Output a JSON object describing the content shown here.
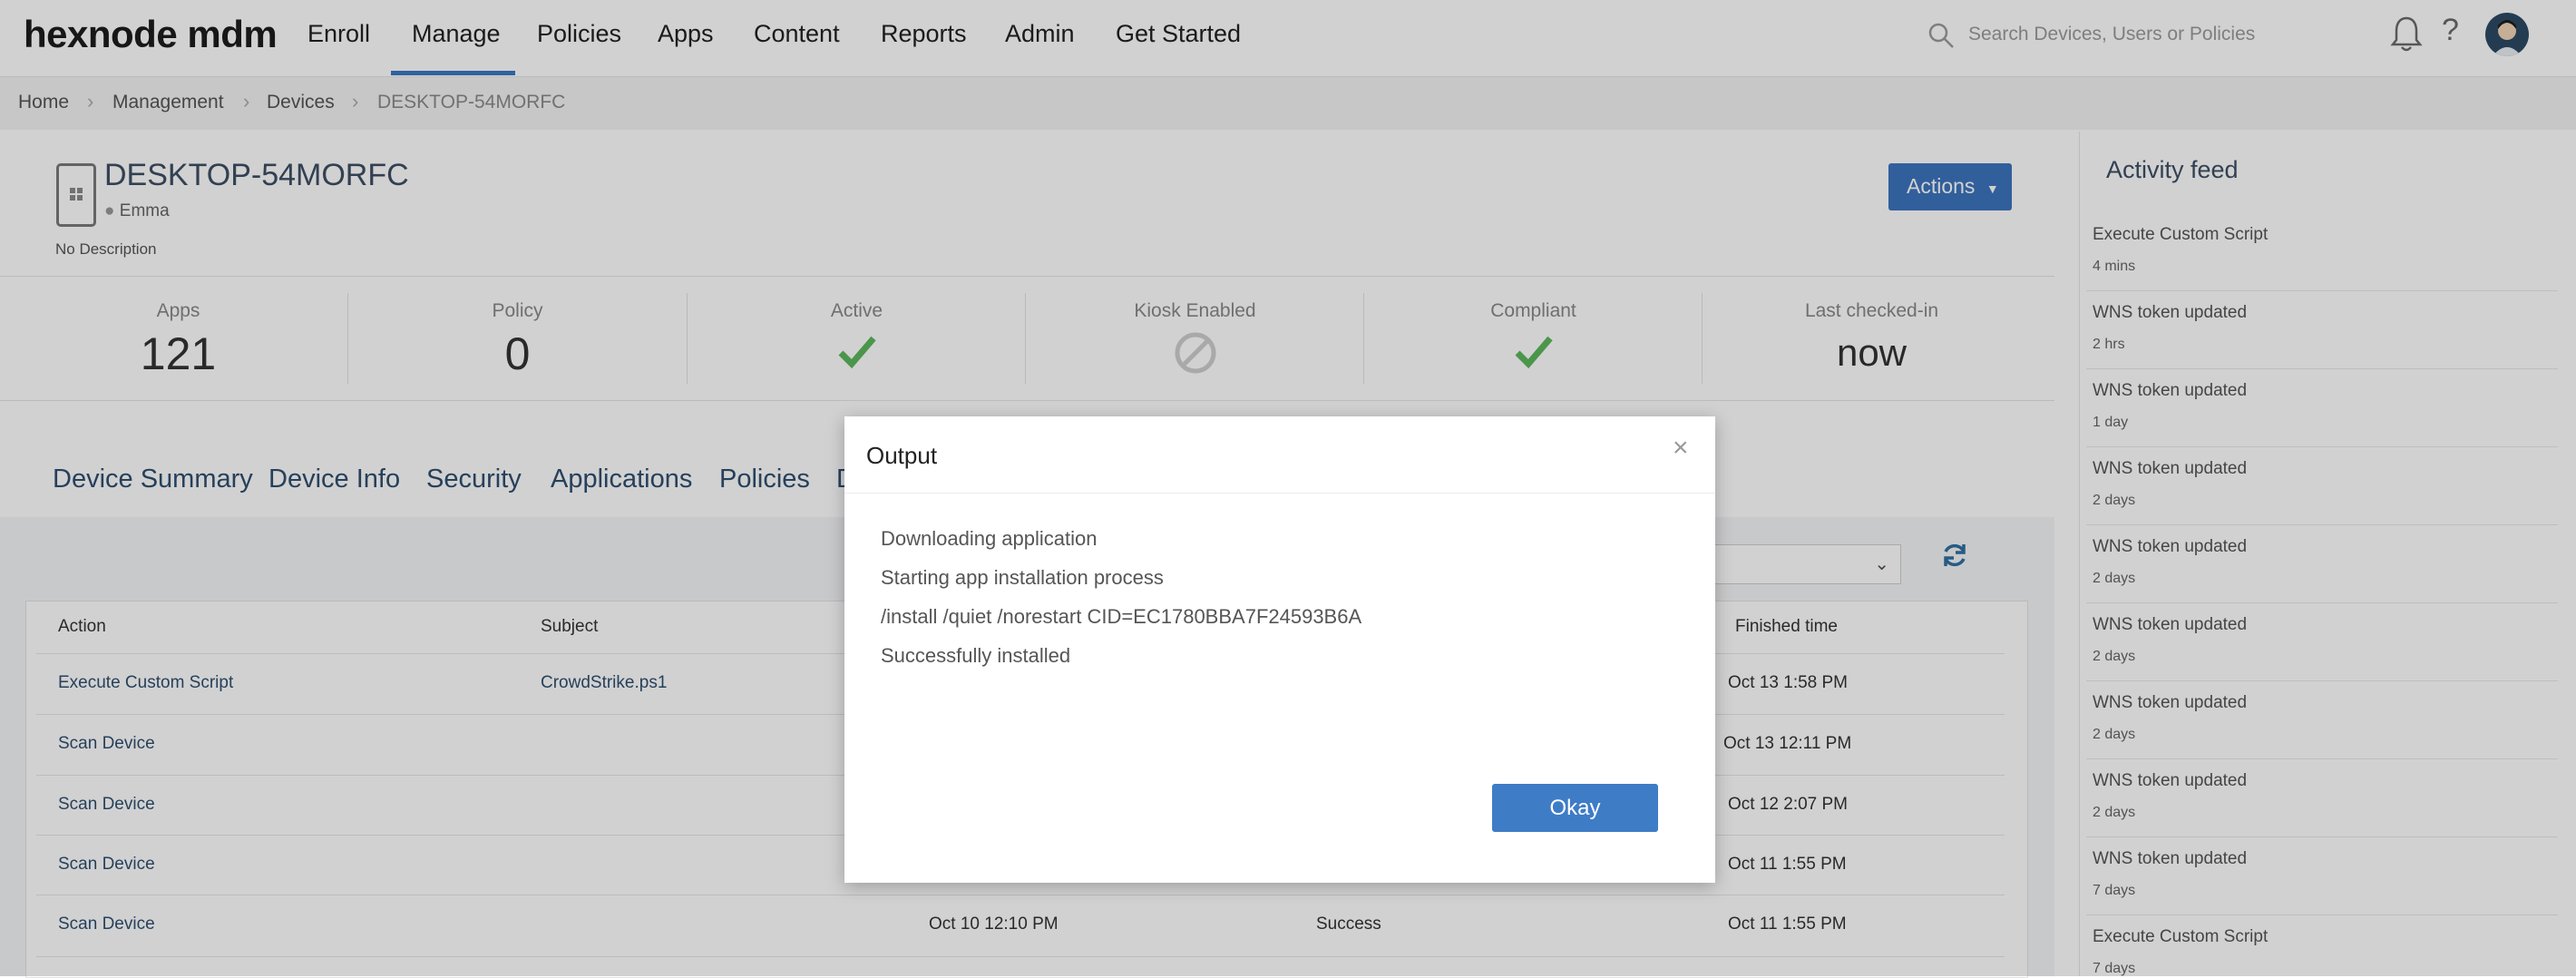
{
  "nav": {
    "logo": "hexnode mdm",
    "items": [
      "Enroll",
      "Manage",
      "Policies",
      "Apps",
      "Content",
      "Reports",
      "Admin",
      "Get Started"
    ],
    "active": "Manage",
    "search_placeholder": "Search Devices, Users or Policies"
  },
  "breadcrumb": [
    "Home",
    "Management",
    "Devices",
    "DESKTOP-54MORFC"
  ],
  "device": {
    "name": "DESKTOP-54MORFC",
    "user": "Emma",
    "description": "No Description",
    "actions_label": "Actions"
  },
  "stats": [
    {
      "label": "Apps",
      "value": "121"
    },
    {
      "label": "Policy",
      "value": "0"
    },
    {
      "label": "Active",
      "icon": "check-icon"
    },
    {
      "label": "Kiosk Enabled",
      "icon": "disabled-icon"
    },
    {
      "label": "Compliant",
      "icon": "check-icon"
    },
    {
      "label": "Last checked-in",
      "value": "now"
    }
  ],
  "tabs": [
    "Device Summary",
    "Device Info",
    "Security",
    "Applications",
    "Policies",
    "D"
  ],
  "table": {
    "headers": [
      "Action",
      "Subject",
      "Finished time"
    ],
    "rows": [
      {
        "action": "Execute Custom Script",
        "subject": "CrowdStrike.ps1",
        "started": "",
        "status": "",
        "finished": "Oct 13 1:58 PM"
      },
      {
        "action": "Scan Device",
        "subject": "",
        "started": "",
        "status": "",
        "finished": "Oct 13 12:11 PM"
      },
      {
        "action": "Scan Device",
        "subject": "",
        "started": "",
        "status": "",
        "finished": "Oct 12 2:07 PM"
      },
      {
        "action": "Scan Device",
        "subject": "",
        "started": "",
        "status": "",
        "finished": "Oct 11 1:55 PM"
      },
      {
        "action": "Scan Device",
        "subject": "",
        "started": "Oct 10 12:10 PM",
        "status": "Success",
        "finished": "Oct 11 1:55 PM"
      }
    ]
  },
  "feed": {
    "title": "Activity feed",
    "items": [
      {
        "title": "Execute Custom Script",
        "time": "4 mins"
      },
      {
        "title": "WNS token updated",
        "time": "2 hrs"
      },
      {
        "title": "WNS token updated",
        "time": "1 day"
      },
      {
        "title": "WNS token updated",
        "time": "2 days"
      },
      {
        "title": "WNS token updated",
        "time": "2 days"
      },
      {
        "title": "WNS token updated",
        "time": "2 days"
      },
      {
        "title": "WNS token updated",
        "time": "2 days"
      },
      {
        "title": "WNS token updated",
        "time": "2 days"
      },
      {
        "title": "WNS token updated",
        "time": "7 days"
      },
      {
        "title": "Execute Custom Script",
        "time": "7 days"
      }
    ]
  },
  "modal": {
    "title": "Output",
    "close": "×",
    "lines": [
      "Downloading application",
      "Starting app installation process",
      "/install /quiet /norestart CID=EC1780BBA7F24593B6A",
      "Successfully installed"
    ],
    "ok_label": "Okay"
  },
  "colors": {
    "accent": "#3c74bd",
    "check": "#5cb85c",
    "link": "#2f4f70"
  }
}
